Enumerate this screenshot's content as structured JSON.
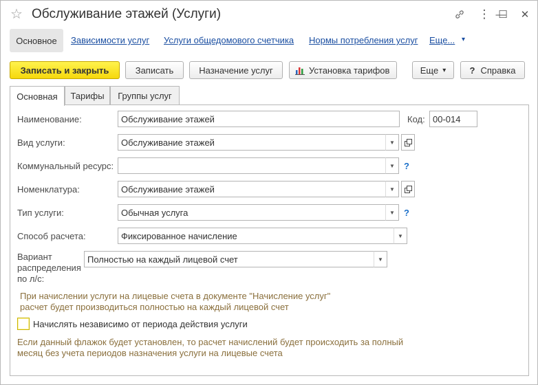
{
  "window": {
    "title": "Обслуживание этажей (Услуги)",
    "star_icon": "☆",
    "link_icon": "🔗",
    "menu_icon": "⋮",
    "minimize_icon": "—",
    "maximize_icon": "☐",
    "close_icon": "✕"
  },
  "nav": {
    "active": "Основное",
    "links": [
      "Зависимости услуг",
      "Услуги общедомового счетчика",
      "Нормы потребления услуг"
    ],
    "more": "Еще..."
  },
  "toolbar": {
    "save_close": "Записать и закрыть",
    "save": "Записать",
    "assign": "Назначение услуг",
    "tariffs": "Установка тарифов",
    "more": "Еще",
    "help": "Справка",
    "help_icon": "?",
    "chevron": "▾"
  },
  "tabs": [
    "Основная",
    "Тарифы",
    "Группы услуг"
  ],
  "form": {
    "name_label": "Наименование:",
    "name_value": "Обслуживание этажей",
    "code_label": "Код:",
    "code_value": "00-014",
    "kind_label": "Вид услуги:",
    "kind_value": "Обслуживание этажей",
    "resource_label": "Коммунальный ресурс:",
    "resource_value": "",
    "nomenclature_label": "Номенклатура:",
    "nomenclature_value": "Обслуживание этажей",
    "type_label": "Тип услуги:",
    "type_value": "Обычная услуга",
    "calc_label": "Способ расчета:",
    "calc_value": "Фиксированное начисление",
    "distrib_label_1": "Вариант",
    "distrib_label_2": "распределения",
    "distrib_label_3": "по л/с:",
    "distrib_value": "Полностью на каждый лицевой счет",
    "dropdown_arrow": "▼",
    "help_mark": "?"
  },
  "hints": {
    "distrib_1": "При начислении услуги на лицевые счета в документе \"Начисление услуг\"",
    "distrib_2": "расчет будет производиться полностью на каждый лицевой счет",
    "checkbox_label": "Начислять независимо от периода действия услуги",
    "checkbox_1": "Если данный флажок будет установлен, то расчет начислений будет происходить за полный",
    "checkbox_2": "месяц без учета периодов назначения услуги на лицевые счета"
  }
}
